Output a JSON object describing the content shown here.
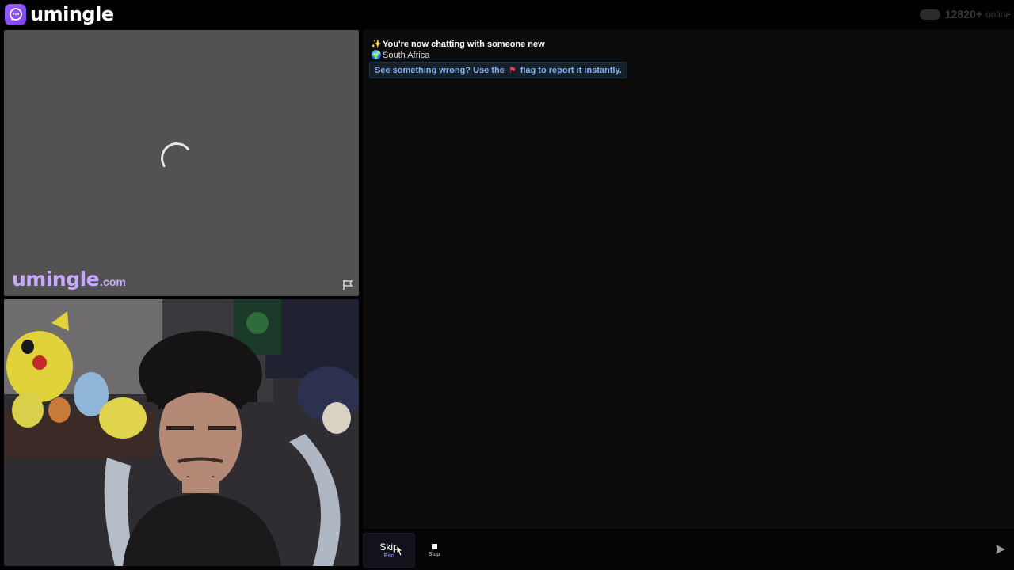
{
  "brand": {
    "name": "umingle",
    "logo_icon": "chat-bubble-icon"
  },
  "status": {
    "online_count": "12820+",
    "online_label": "online"
  },
  "remote_video": {
    "state": "loading",
    "watermark_main": "umingle",
    "watermark_domain": ".com",
    "report_icon": "flag-icon"
  },
  "local_video": {
    "description": "self camera feed"
  },
  "chat": {
    "connected_line": "You're now chatting with someone new",
    "connected_emoji": "sparkles",
    "country_emoji": "globe",
    "country": "South Africa",
    "report_prefix": "See something wrong? Use the",
    "report_suffix": "flag to report it instantly."
  },
  "controls": {
    "skip_label": "Skip",
    "skip_hint": "Esc",
    "stop_label": "Stop",
    "message_placeholder": "",
    "send_icon": "send-icon"
  },
  "colors": {
    "accent": "#8b5cf6",
    "watermark": "#c7a9ff",
    "report_text": "#7fb4ef",
    "report_bg": "#15202b"
  }
}
